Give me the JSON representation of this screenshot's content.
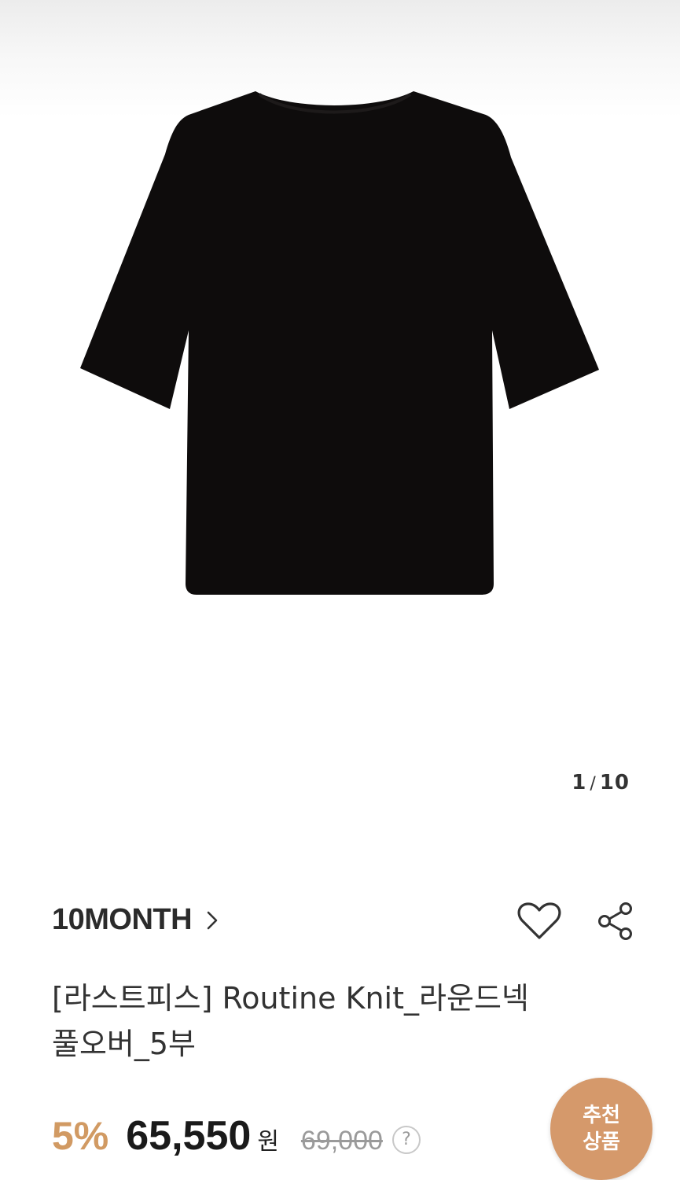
{
  "gallery": {
    "current": "1",
    "separator": "/",
    "total": "10",
    "image_alt": "black short sleeve knit pullover"
  },
  "product": {
    "brand": "10MONTH",
    "title_line1": "[라스트피스] Routine Knit_라운드넥",
    "title_line2": "풀오버_5부",
    "discount": "5%",
    "price": "65,550",
    "currency": "원",
    "original_price": "69,000",
    "help_glyph": "?"
  },
  "actions": {
    "wishlist_icon": "heart-icon",
    "share_icon": "share-icon"
  },
  "recommend_button": {
    "line1": "추천",
    "line2": "상품"
  },
  "colors": {
    "accent": "#d19a63",
    "recommend_bg": "#d5996b",
    "garment": "#0e0c0c"
  }
}
